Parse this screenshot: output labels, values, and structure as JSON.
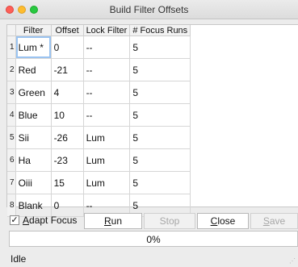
{
  "window": {
    "title": "Build Filter Offsets",
    "controls": [
      "close",
      "minimize",
      "zoom"
    ]
  },
  "table": {
    "columns": [
      "Filter",
      "Offset",
      "Lock Filter",
      "# Focus Runs"
    ],
    "rows": [
      {
        "num": "1",
        "filter": "Lum *",
        "offset": "0",
        "lock": "--",
        "runs": "5"
      },
      {
        "num": "2",
        "filter": "Red",
        "offset": "-21",
        "lock": "--",
        "runs": "5"
      },
      {
        "num": "3",
        "filter": "Green",
        "offset": "4",
        "lock": "--",
        "runs": "5"
      },
      {
        "num": "4",
        "filter": "Blue",
        "offset": "10",
        "lock": "--",
        "runs": "5"
      },
      {
        "num": "5",
        "filter": "Sii",
        "offset": "-26",
        "lock": "Lum",
        "runs": "5"
      },
      {
        "num": "6",
        "filter": "Ha",
        "offset": "-23",
        "lock": "Lum",
        "runs": "5"
      },
      {
        "num": "7",
        "filter": "Oiii",
        "offset": "15",
        "lock": "Lum",
        "runs": "5"
      },
      {
        "num": "8",
        "filter": "Blank",
        "offset": "0",
        "lock": "--",
        "runs": "5"
      }
    ]
  },
  "controls": {
    "adapt_focus_label": "Adapt Focus",
    "adapt_focus_checked": true,
    "run_label": "Run",
    "stop_label": "Stop",
    "close_label": "Close",
    "save_label": "Save"
  },
  "progress": {
    "value": 0,
    "text": "0%"
  },
  "status": {
    "text": "Idle"
  },
  "colors": {
    "close": "#fe5f57",
    "minimize": "#febc2e",
    "zoom": "#28c840",
    "selection": "#9ac3f0"
  }
}
